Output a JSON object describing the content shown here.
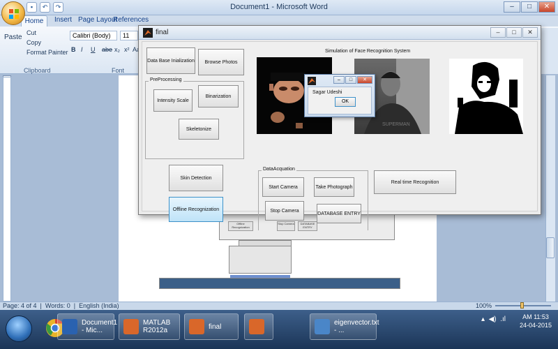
{
  "word": {
    "title": "Document1 - Microsoft Word",
    "tabs": [
      "Home",
      "Insert",
      "Page Layout",
      "References"
    ],
    "clipboard": {
      "cut": "Cut",
      "copy": "Copy",
      "paste": "Paste",
      "format_painter": "Format Painter",
      "group": "Clipboard"
    },
    "font": {
      "family": "Calibri (Body)",
      "size": "11",
      "group": "Font",
      "bold": "B",
      "italic": "I",
      "underline": "U",
      "strike": "abe",
      "sub": "x₂",
      "sup": "x²",
      "aa": "Aa"
    },
    "status": {
      "page": "Page: 4 of 4",
      "words": "Words: 0",
      "language": "English (India)",
      "zoom": "100%"
    }
  },
  "taskbar": {
    "items": [
      {
        "label": "Document1 - Mic...",
        "color": "#2a62b0"
      },
      {
        "label": "MATLAB R2012a",
        "color": "#d9672a"
      },
      {
        "label": "final",
        "color": "#d9672a"
      },
      {
        "label": "",
        "color": "#d9672a"
      },
      {
        "label": "eigenvector.txt - ...",
        "color": "#4a86c8"
      }
    ],
    "clock_time": "AM 11:53",
    "clock_date": "24-04-2015"
  },
  "figure": {
    "title": "final",
    "sim_title": "Simulation of Face Recognition System",
    "buttons": {
      "db_init": "Data Base Inialization",
      "browse": "Browse Photos",
      "intensity": "Intensity Scale",
      "binarization": "Binarization",
      "skeletonize": "Skeletonize",
      "skin": "Skin Detection",
      "offline": "Offline Recognization",
      "start_camera": "Start Camera",
      "take_photo": "Take Photograph",
      "stop_camera": "Stop Camera",
      "db_entry": "DATABASE ENTRY",
      "realtime": "Real time Recognition"
    },
    "panels": {
      "preprocessing": "PreProcessing",
      "data_acq": "DataAcquation"
    }
  },
  "msgbox": {
    "text": "Sagar Udeshi",
    "ok": "OK"
  },
  "colors": {
    "accent_blue": "#bfe3f8",
    "taskbar": "#1b3557",
    "ribbon": "#dbe6f3"
  }
}
